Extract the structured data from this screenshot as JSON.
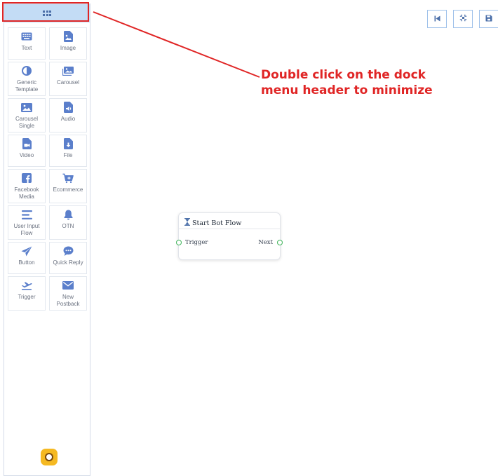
{
  "dock": {
    "items": [
      {
        "label": "Text",
        "icon": "keyboard-icon"
      },
      {
        "label": "Image",
        "icon": "image-file-icon"
      },
      {
        "label": "Generic\nTemplate",
        "icon": "half-circle-icon"
      },
      {
        "label": "Carousel",
        "icon": "images-icon"
      },
      {
        "label": "Carousel\nSingle",
        "icon": "image-icon"
      },
      {
        "label": "Audio",
        "icon": "audio-file-icon"
      },
      {
        "label": "Video",
        "icon": "video-file-icon"
      },
      {
        "label": "File",
        "icon": "download-file-icon"
      },
      {
        "label": "Facebook\nMedia",
        "icon": "facebook-icon"
      },
      {
        "label": "Ecommerce",
        "icon": "cart-plus-icon"
      },
      {
        "label": "User Input\nFlow",
        "icon": "lines-icon"
      },
      {
        "label": "OTN",
        "icon": "bell-icon"
      },
      {
        "label": "Button",
        "icon": "paper-plane-icon"
      },
      {
        "label": "Quick Reply",
        "icon": "chat-bubble-icon"
      },
      {
        "label": "Trigger",
        "icon": "plane-departure-icon"
      },
      {
        "label": "New\nPostback",
        "icon": "envelope-icon"
      }
    ],
    "avatar_icon": "bot-icon"
  },
  "toolbar": {
    "buttons": [
      {
        "icon": "skip-back-icon"
      },
      {
        "icon": "fit-screen-icon"
      },
      {
        "icon": "save-icon"
      }
    ]
  },
  "callout": {
    "text": "Double click on the dock\nmenu header to minimize"
  },
  "node": {
    "title": "Start Bot Flow",
    "input_label": "Trigger",
    "output_label": "Next"
  },
  "colors": {
    "accent": "#5b7fcb",
    "callout": "#e02525",
    "header": "#c3dcf5",
    "port": "#3fb45a"
  }
}
